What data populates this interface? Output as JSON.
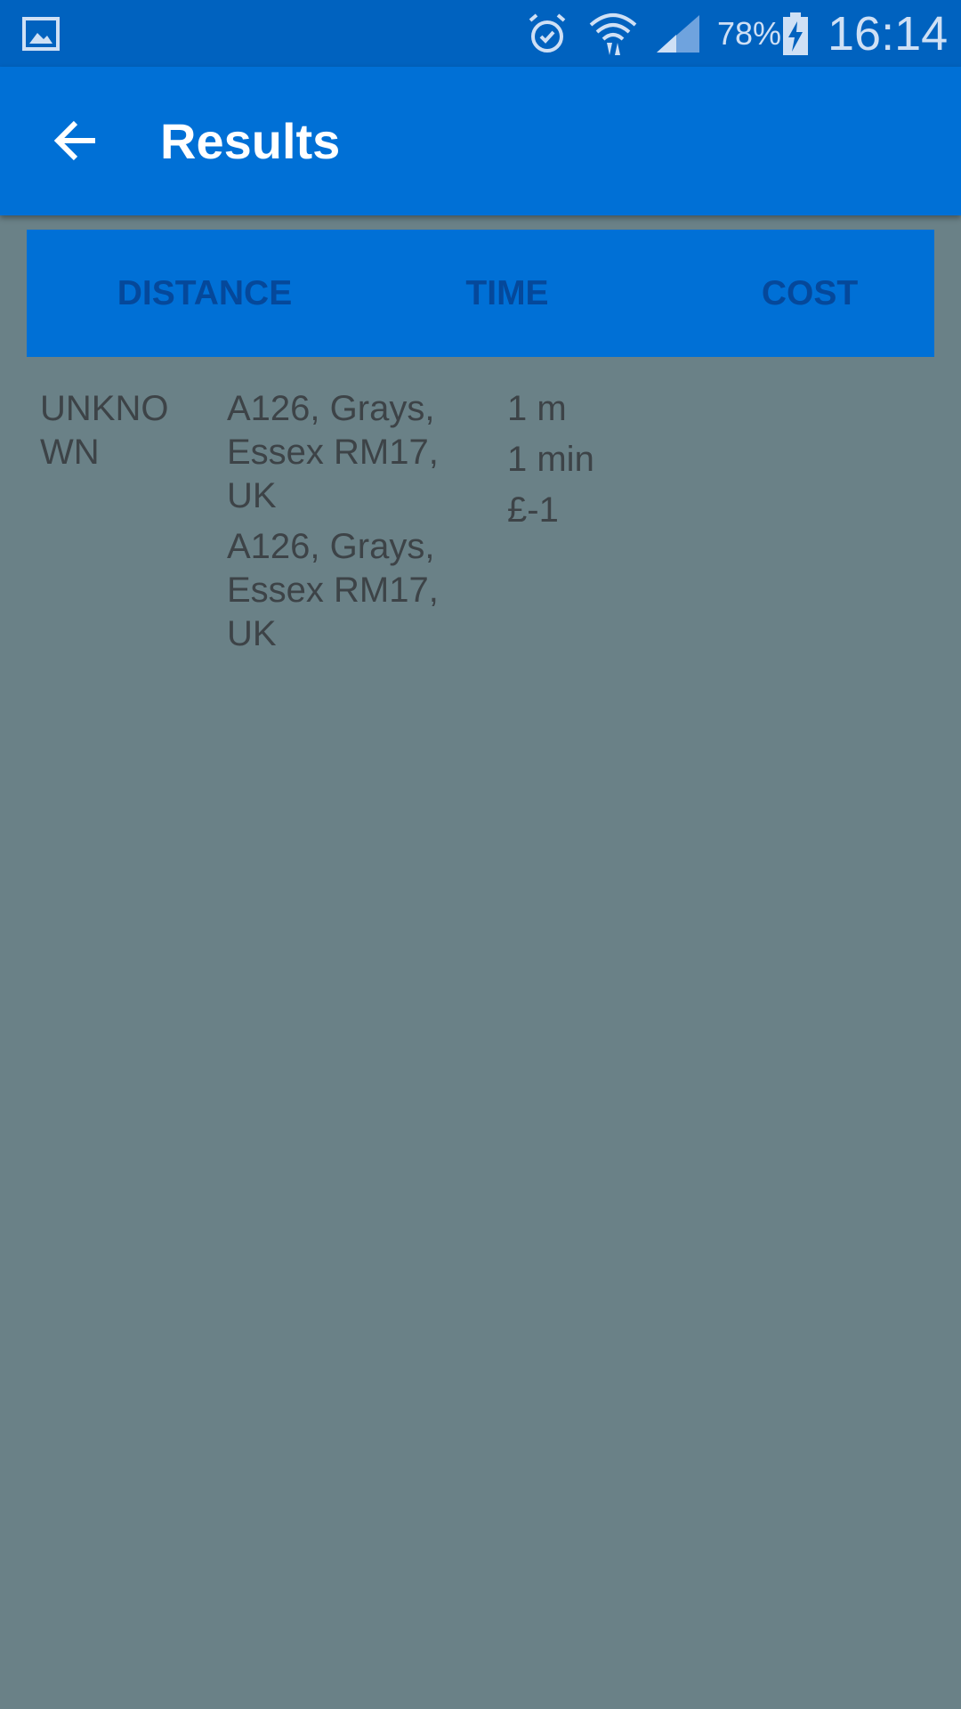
{
  "status_bar": {
    "battery_percent": "78%",
    "time": "16:14",
    "icons": [
      "gallery-icon",
      "alarm-icon",
      "wifi-icon",
      "signal-icon",
      "battery-charging-icon"
    ]
  },
  "app_bar": {
    "title": "Results",
    "back_icon": "arrow-back-icon"
  },
  "tabs": [
    {
      "label": "DISTANCE"
    },
    {
      "label": "TIME"
    },
    {
      "label": "COST"
    }
  ],
  "result": {
    "name_line1": "UNKNO",
    "name_line2": "WN",
    "from_address": "A126, Grays, Essex RM17, UK",
    "to_address": "A126, Grays, Essex RM17, UK",
    "distance": "1 m",
    "time": "1 min",
    "cost": "£-1"
  },
  "colors": {
    "status_bar": "#0062bf",
    "app_bar": "#0070d6",
    "tab_text": "#05489a",
    "background_overlay": "#6a8187",
    "body_text": "#3d4347"
  }
}
